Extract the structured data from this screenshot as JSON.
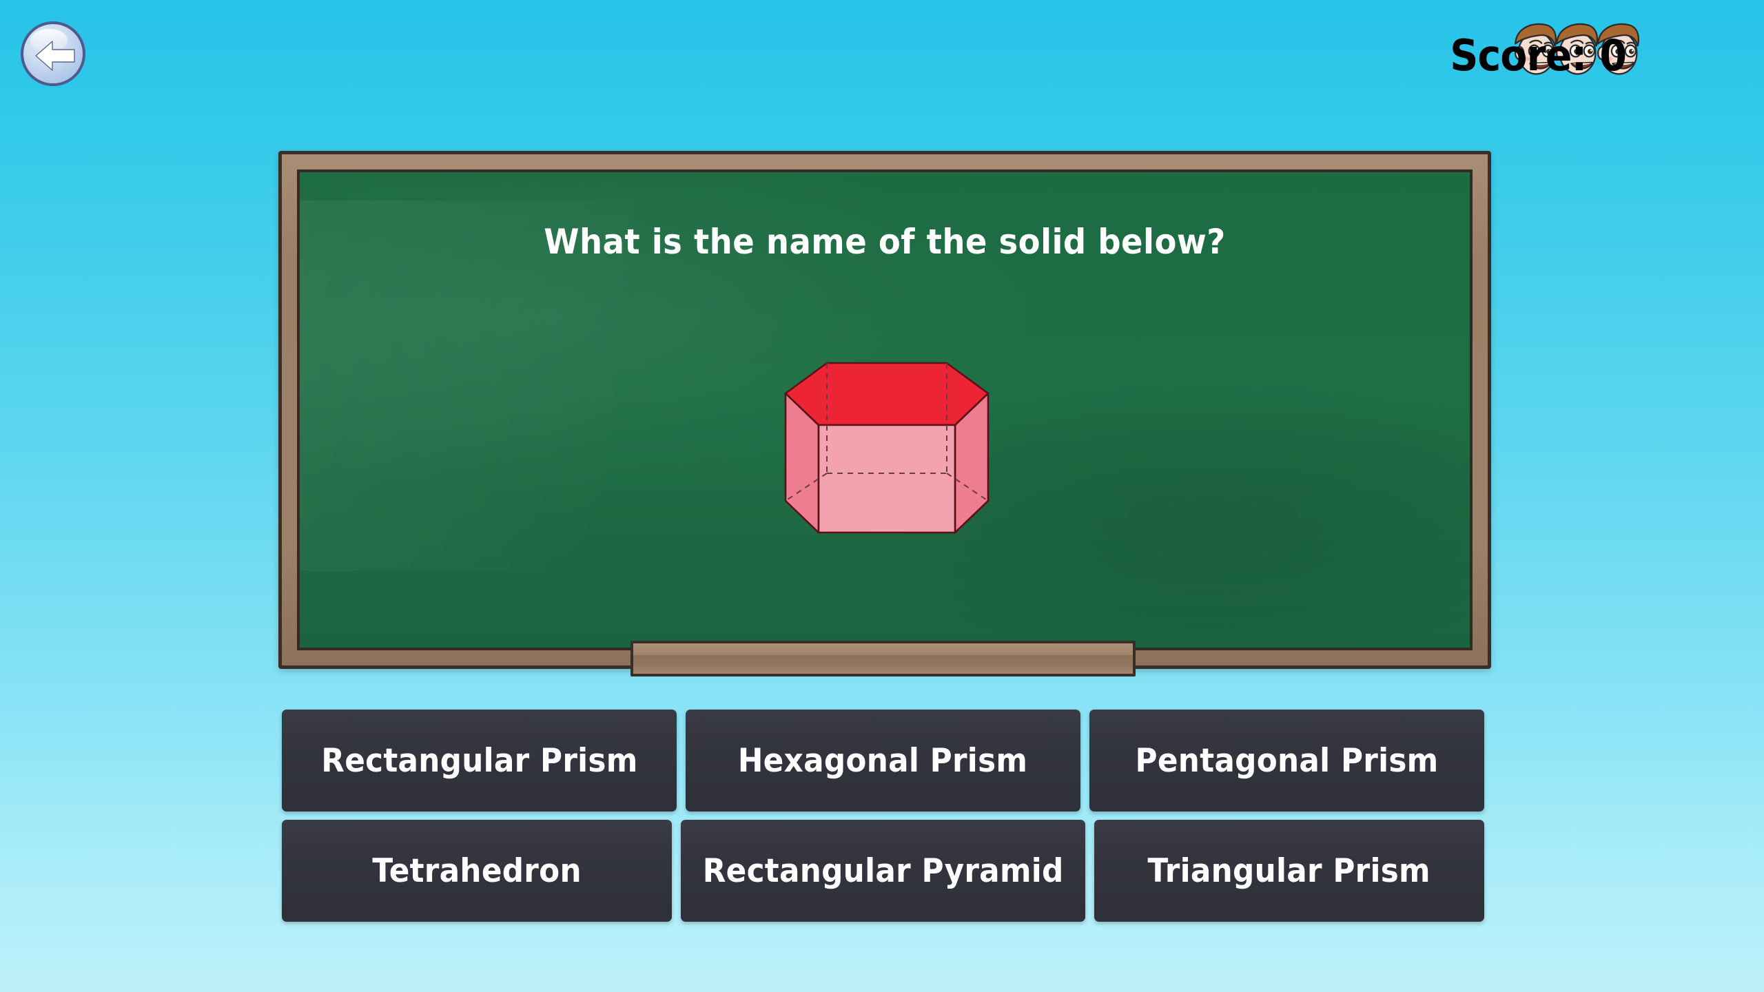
{
  "header": {
    "back_button_label": "Back",
    "back_icon": "left-arrow-icon",
    "score_text": "Score: 0",
    "score_value": 0,
    "lives_count": 3,
    "life_icon": "boy-face-icon"
  },
  "board": {
    "question": "What is the name of the solid below?",
    "solid": {
      "name": "hexagonal-prism",
      "top_face_color": "#ed2434",
      "front_face_color": "#f2a3ae",
      "side_face_color": "#ef7d90",
      "edge_color": "#5c1018",
      "hidden_edge_style": "dashed"
    }
  },
  "answers": {
    "rows": [
      [
        {
          "label": "Rectangular Prism",
          "name": "answer-rectangular-prism"
        },
        {
          "label": "Hexagonal Prism",
          "name": "answer-hexagonal-prism"
        },
        {
          "label": "Pentagonal Prism",
          "name": "answer-pentagonal-prism"
        }
      ],
      [
        {
          "label": "Tetrahedron",
          "name": "answer-tetrahedron"
        },
        {
          "label": "Rectangular Pyramid",
          "name": "answer-rectangular-pyramid"
        },
        {
          "label": "Triangular Prism",
          "name": "answer-triangular-prism"
        }
      ]
    ]
  },
  "theme": {
    "background_top": "#27c3e8",
    "background_bottom": "#bdf1fa",
    "board_green": "#1f6f46",
    "board_frame_brown": "#9d8168",
    "button_dark": "#33343e",
    "text_white": "#ffffff",
    "score_text_color": "#000000"
  }
}
